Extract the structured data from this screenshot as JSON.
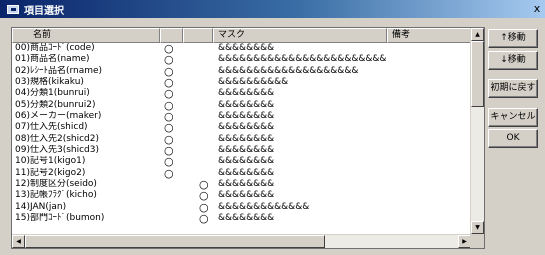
{
  "window": {
    "title": "項目選択",
    "close_label": "x"
  },
  "columns": [
    "名前",
    "",
    "",
    "マスク",
    "備考"
  ],
  "rows": [
    {
      "name": "00)商品ｺｰﾄﾞ(code)",
      "m1": "○",
      "m2": "",
      "mask": "&&&&&&&&"
    },
    {
      "name": "01)商品名(name)",
      "m1": "○",
      "m2": "",
      "mask": "&&&&&&&&&&&&&&&&&&&&&&&&&&..."
    },
    {
      "name": "02)ﾚｼｰﾄ品名(rname)",
      "m1": "○",
      "m2": "",
      "mask": "&&&&&&&&&&&&&&&&&&&&"
    },
    {
      "name": "03)規格(kikaku)",
      "m1": "○",
      "m2": "",
      "mask": "&&&&&&&&&&"
    },
    {
      "name": "04)分類1(bunrui)",
      "m1": "○",
      "m2": "",
      "mask": "&&&&&&&&"
    },
    {
      "name": "05)分類2(bunrui2)",
      "m1": "○",
      "m2": "",
      "mask": "&&&&&&&&"
    },
    {
      "name": "06)メーカー(maker)",
      "m1": "○",
      "m2": "",
      "mask": "&&&&&&&&"
    },
    {
      "name": "07)仕入先(shicd)",
      "m1": "○",
      "m2": "",
      "mask": "&&&&&&&&"
    },
    {
      "name": "08)仕入先2(shicd2)",
      "m1": "○",
      "m2": "",
      "mask": "&&&&&&&&"
    },
    {
      "name": "09)仕入先3(shicd3)",
      "m1": "○",
      "m2": "",
      "mask": "&&&&&&&&"
    },
    {
      "name": "10)記号1(kigo1)",
      "m1": "○",
      "m2": "",
      "mask": "&&&&&&&&"
    },
    {
      "name": "11)記号2(kigo2)",
      "m1": "○",
      "m2": "",
      "mask": "&&&&&&&&"
    },
    {
      "name": "12)制度区分(seido)",
      "m1": "",
      "m2": "○",
      "mask": "&&&&&&&&"
    },
    {
      "name": "13)記帳ﾌﾗｸﾞ(kicho)",
      "m1": "",
      "m2": "○",
      "mask": "&&&&&&&&"
    },
    {
      "name": "14)JAN(jan)",
      "m1": "",
      "m2": "○",
      "mask": "&&&&&&&&&&&&&"
    },
    {
      "name": "15)部門ｺｰﾄﾞ(bumon)",
      "m1": "",
      "m2": "○",
      "mask": "&&&&&&&&"
    }
  ],
  "buttons": {
    "move_up": "↑移動",
    "move_down": "↓移動",
    "reset": "初期に戻す",
    "cancel": "キャンセル",
    "ok": "OK"
  },
  "icons": {
    "scroll_up": "up-arrow-icon",
    "scroll_down": "down-arrow-icon",
    "scroll_left": "left-arrow-icon",
    "scroll_right": "right-arrow-icon"
  }
}
